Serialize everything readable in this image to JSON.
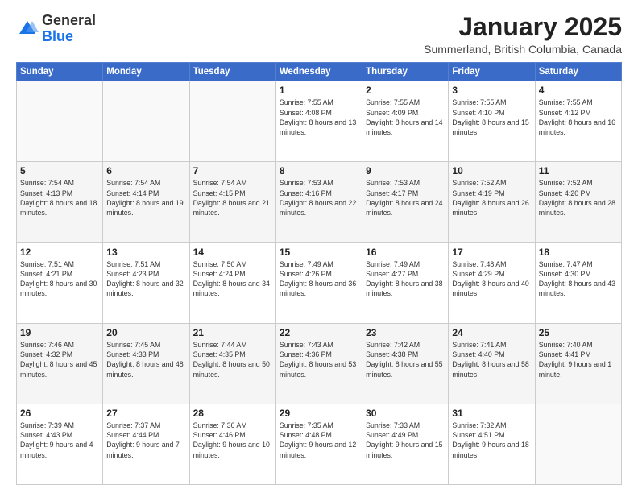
{
  "header": {
    "logo_general": "General",
    "logo_blue": "Blue",
    "month_title": "January 2025",
    "location": "Summerland, British Columbia, Canada"
  },
  "weekdays": [
    "Sunday",
    "Monday",
    "Tuesday",
    "Wednesday",
    "Thursday",
    "Friday",
    "Saturday"
  ],
  "weeks": [
    [
      {
        "day": "",
        "info": ""
      },
      {
        "day": "",
        "info": ""
      },
      {
        "day": "",
        "info": ""
      },
      {
        "day": "1",
        "info": "Sunrise: 7:55 AM\nSunset: 4:08 PM\nDaylight: 8 hours\nand 13 minutes."
      },
      {
        "day": "2",
        "info": "Sunrise: 7:55 AM\nSunset: 4:09 PM\nDaylight: 8 hours\nand 14 minutes."
      },
      {
        "day": "3",
        "info": "Sunrise: 7:55 AM\nSunset: 4:10 PM\nDaylight: 8 hours\nand 15 minutes."
      },
      {
        "day": "4",
        "info": "Sunrise: 7:55 AM\nSunset: 4:12 PM\nDaylight: 8 hours\nand 16 minutes."
      }
    ],
    [
      {
        "day": "5",
        "info": "Sunrise: 7:54 AM\nSunset: 4:13 PM\nDaylight: 8 hours\nand 18 minutes."
      },
      {
        "day": "6",
        "info": "Sunrise: 7:54 AM\nSunset: 4:14 PM\nDaylight: 8 hours\nand 19 minutes."
      },
      {
        "day": "7",
        "info": "Sunrise: 7:54 AM\nSunset: 4:15 PM\nDaylight: 8 hours\nand 21 minutes."
      },
      {
        "day": "8",
        "info": "Sunrise: 7:53 AM\nSunset: 4:16 PM\nDaylight: 8 hours\nand 22 minutes."
      },
      {
        "day": "9",
        "info": "Sunrise: 7:53 AM\nSunset: 4:17 PM\nDaylight: 8 hours\nand 24 minutes."
      },
      {
        "day": "10",
        "info": "Sunrise: 7:52 AM\nSunset: 4:19 PM\nDaylight: 8 hours\nand 26 minutes."
      },
      {
        "day": "11",
        "info": "Sunrise: 7:52 AM\nSunset: 4:20 PM\nDaylight: 8 hours\nand 28 minutes."
      }
    ],
    [
      {
        "day": "12",
        "info": "Sunrise: 7:51 AM\nSunset: 4:21 PM\nDaylight: 8 hours\nand 30 minutes."
      },
      {
        "day": "13",
        "info": "Sunrise: 7:51 AM\nSunset: 4:23 PM\nDaylight: 8 hours\nand 32 minutes."
      },
      {
        "day": "14",
        "info": "Sunrise: 7:50 AM\nSunset: 4:24 PM\nDaylight: 8 hours\nand 34 minutes."
      },
      {
        "day": "15",
        "info": "Sunrise: 7:49 AM\nSunset: 4:26 PM\nDaylight: 8 hours\nand 36 minutes."
      },
      {
        "day": "16",
        "info": "Sunrise: 7:49 AM\nSunset: 4:27 PM\nDaylight: 8 hours\nand 38 minutes."
      },
      {
        "day": "17",
        "info": "Sunrise: 7:48 AM\nSunset: 4:29 PM\nDaylight: 8 hours\nand 40 minutes."
      },
      {
        "day": "18",
        "info": "Sunrise: 7:47 AM\nSunset: 4:30 PM\nDaylight: 8 hours\nand 43 minutes."
      }
    ],
    [
      {
        "day": "19",
        "info": "Sunrise: 7:46 AM\nSunset: 4:32 PM\nDaylight: 8 hours\nand 45 minutes."
      },
      {
        "day": "20",
        "info": "Sunrise: 7:45 AM\nSunset: 4:33 PM\nDaylight: 8 hours\nand 48 minutes."
      },
      {
        "day": "21",
        "info": "Sunrise: 7:44 AM\nSunset: 4:35 PM\nDaylight: 8 hours\nand 50 minutes."
      },
      {
        "day": "22",
        "info": "Sunrise: 7:43 AM\nSunset: 4:36 PM\nDaylight: 8 hours\nand 53 minutes."
      },
      {
        "day": "23",
        "info": "Sunrise: 7:42 AM\nSunset: 4:38 PM\nDaylight: 8 hours\nand 55 minutes."
      },
      {
        "day": "24",
        "info": "Sunrise: 7:41 AM\nSunset: 4:40 PM\nDaylight: 8 hours\nand 58 minutes."
      },
      {
        "day": "25",
        "info": "Sunrise: 7:40 AM\nSunset: 4:41 PM\nDaylight: 9 hours\nand 1 minute."
      }
    ],
    [
      {
        "day": "26",
        "info": "Sunrise: 7:39 AM\nSunset: 4:43 PM\nDaylight: 9 hours\nand 4 minutes."
      },
      {
        "day": "27",
        "info": "Sunrise: 7:37 AM\nSunset: 4:44 PM\nDaylight: 9 hours\nand 7 minutes."
      },
      {
        "day": "28",
        "info": "Sunrise: 7:36 AM\nSunset: 4:46 PM\nDaylight: 9 hours\nand 10 minutes."
      },
      {
        "day": "29",
        "info": "Sunrise: 7:35 AM\nSunset: 4:48 PM\nDaylight: 9 hours\nand 12 minutes."
      },
      {
        "day": "30",
        "info": "Sunrise: 7:33 AM\nSunset: 4:49 PM\nDaylight: 9 hours\nand 15 minutes."
      },
      {
        "day": "31",
        "info": "Sunrise: 7:32 AM\nSunset: 4:51 PM\nDaylight: 9 hours\nand 18 minutes."
      },
      {
        "day": "",
        "info": ""
      }
    ]
  ]
}
